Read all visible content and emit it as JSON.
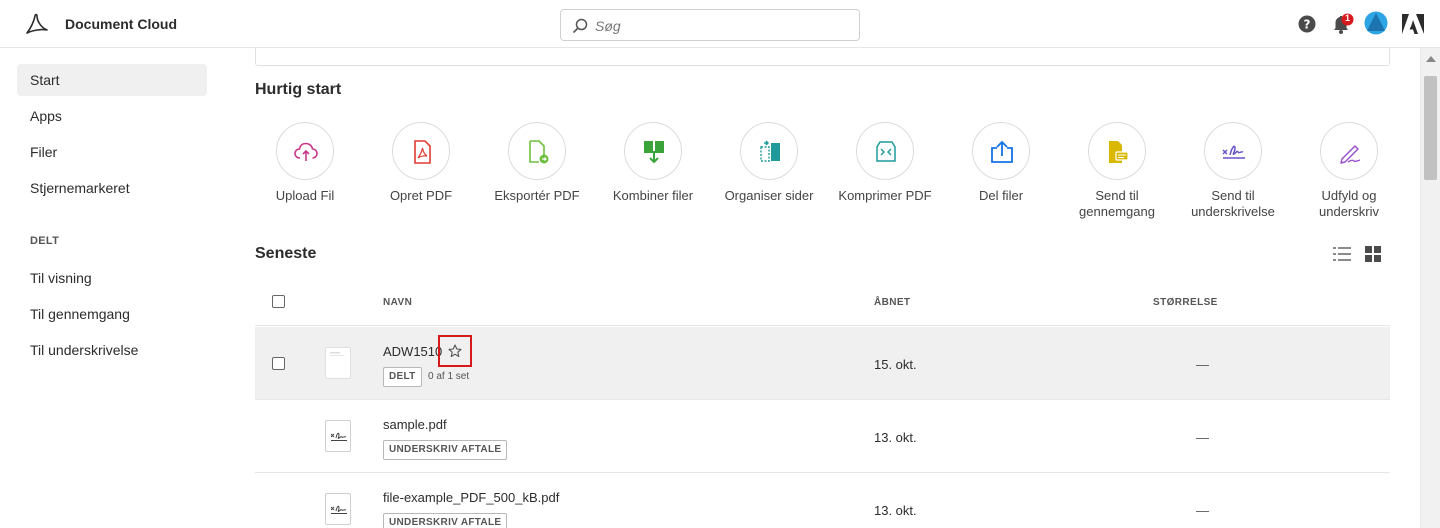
{
  "app": {
    "title": "Document Cloud"
  },
  "search": {
    "placeholder": "Søg"
  },
  "topbar": {
    "notification_count": "1"
  },
  "sidebar": {
    "items": [
      {
        "label": "Start",
        "active": true
      },
      {
        "label": "Apps"
      },
      {
        "label": "Filer"
      },
      {
        "label": "Stjernemarkeret"
      }
    ],
    "shared_heading": "DELT",
    "shared_items": [
      {
        "label": "Til visning"
      },
      {
        "label": "Til gennemgang"
      },
      {
        "label": "Til underskrivelse"
      }
    ]
  },
  "quick_start": {
    "title": "Hurtig start",
    "tools": [
      {
        "label": "Upload Fil",
        "icon": "cloud-upload-icon",
        "color": "#c8388a"
      },
      {
        "label": "Opret PDF",
        "icon": "create-pdf-icon",
        "color": "#e03c31"
      },
      {
        "label": "Eksportér PDF",
        "icon": "export-pdf-icon",
        "color": "#6fbf3f"
      },
      {
        "label": "Kombiner filer",
        "icon": "combine-files-icon",
        "color": "#3aa43a"
      },
      {
        "label": "Organiser sider",
        "icon": "organize-pages-icon",
        "color": "#1e9a9a"
      },
      {
        "label": "Komprimer PDF",
        "icon": "compress-pdf-icon",
        "color": "#1e9a9a"
      },
      {
        "label": "Del filer",
        "icon": "share-files-icon",
        "color": "#1473e6"
      },
      {
        "label": "Send til gennemgang",
        "icon": "send-review-icon",
        "color": "#d9b800"
      },
      {
        "label": "Send til underskrivelse",
        "icon": "send-signature-icon",
        "color": "#6a52c9"
      },
      {
        "label": "Udfyld og underskriv",
        "icon": "fill-sign-icon",
        "color": "#9a52c9"
      }
    ]
  },
  "recent": {
    "title": "Seneste",
    "columns": {
      "name": "NAVN",
      "opened": "ÅBNET",
      "size": "STØRRELSE"
    },
    "rows": [
      {
        "name": "ADW1510",
        "tag": "DELT",
        "sub": "0 af 1 set",
        "opened": "15. okt.",
        "size": "—"
      },
      {
        "name": "sample.pdf",
        "tag": "UNDERSKRIV AFTALE",
        "opened": "13. okt.",
        "size": "—"
      },
      {
        "name": "file-example_PDF_500_kB.pdf",
        "tag": "UNDERSKRIV AFTALE",
        "opened": "13. okt.",
        "size": "—"
      }
    ]
  },
  "colors": {
    "accent_red": "#d7191c",
    "notification_badge": "#d7191c",
    "avatar": "#2da4e3"
  }
}
